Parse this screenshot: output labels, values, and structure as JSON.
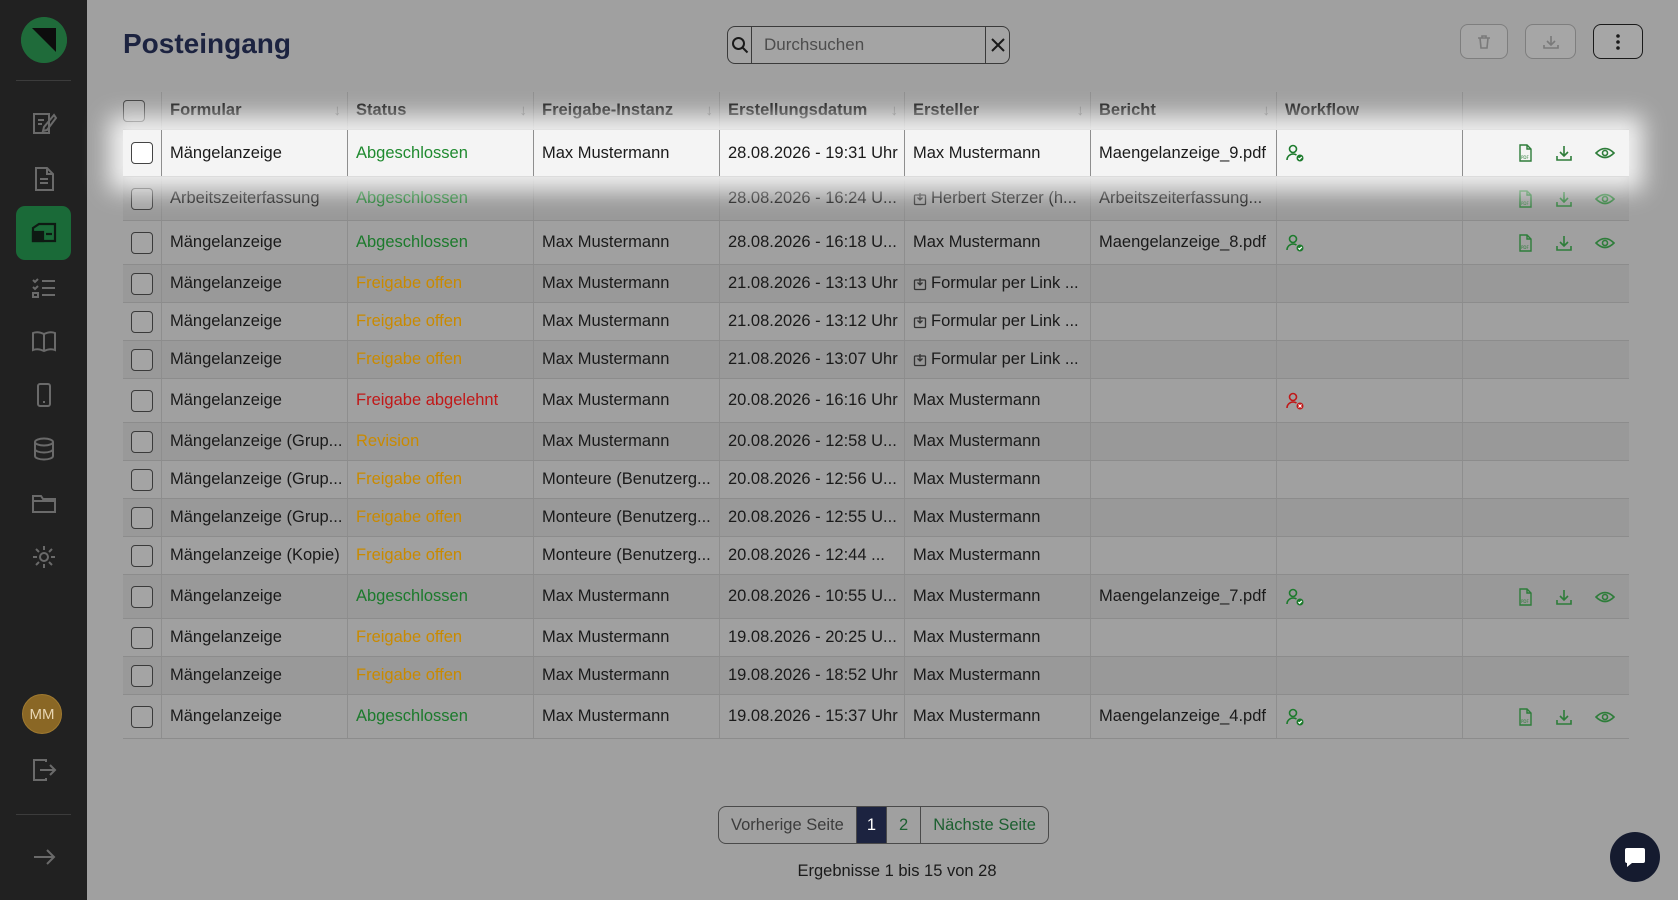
{
  "page": {
    "title": "Posteingang"
  },
  "search": {
    "placeholder": "Durchsuchen"
  },
  "user": {
    "initials": "MM"
  },
  "colors": {
    "accent": "#1a6a38",
    "brand_dark": "#1c2340",
    "status_done": "#1c7a2c",
    "status_open": "#c98a00",
    "status_rejected": "#c01818"
  },
  "sidebar": {
    "items": [
      {
        "icon": "form-edit-icon"
      },
      {
        "icon": "document-icon"
      },
      {
        "icon": "inbox-icon",
        "active": true
      },
      {
        "icon": "checklist-icon"
      },
      {
        "icon": "book-icon"
      },
      {
        "icon": "mobile-icon"
      },
      {
        "icon": "database-icon"
      },
      {
        "icon": "folder-icon"
      },
      {
        "icon": "gear-icon"
      }
    ]
  },
  "table": {
    "headers": [
      "Formular",
      "Status",
      "Freigabe-Instanz",
      "Erstellungsdatum",
      "Ersteller",
      "Bericht",
      "Workflow"
    ],
    "rows": [
      {
        "form": "Mängelanzeige",
        "status": "Abgeschlossen",
        "statusType": "done",
        "instanz": "Max Mustermann",
        "date": "28.08.2026 - 19:31 Uhr",
        "creator": "Max Mustermann",
        "linkCreator": false,
        "report": "Maengelanzeige_9.pdf",
        "workflow": "approved",
        "actions": true,
        "highlight": true
      },
      {
        "form": "Arbeitszeiterfassung",
        "status": "Abgeschlossen",
        "statusType": "done",
        "instanz": "",
        "date": "28.08.2026 - 16:24 U...",
        "creator": "Herbert Sterzer (h...",
        "linkCreator": true,
        "report": "Arbeitszeiterfassung...",
        "workflow": "",
        "actions": true
      },
      {
        "form": "Mängelanzeige",
        "status": "Abgeschlossen",
        "statusType": "done",
        "instanz": "Max Mustermann",
        "date": "28.08.2026 - 16:18 U...",
        "creator": "Max Mustermann",
        "linkCreator": false,
        "report": "Maengelanzeige_8.pdf",
        "workflow": "approved",
        "actions": true
      },
      {
        "form": "Mängelanzeige",
        "status": "Freigabe offen",
        "statusType": "open",
        "instanz": "Max Mustermann",
        "date": "21.08.2026 - 13:13 Uhr",
        "creator": "Formular per Link ...",
        "linkCreator": true,
        "report": "",
        "workflow": "",
        "actions": false
      },
      {
        "form": "Mängelanzeige",
        "status": "Freigabe offen",
        "statusType": "open",
        "instanz": "Max Mustermann",
        "date": "21.08.2026 - 13:12 Uhr",
        "creator": "Formular per Link ...",
        "linkCreator": true,
        "report": "",
        "workflow": "",
        "actions": false
      },
      {
        "form": "Mängelanzeige",
        "status": "Freigabe offen",
        "statusType": "open",
        "instanz": "Max Mustermann",
        "date": "21.08.2026 - 13:07 Uhr",
        "creator": "Formular per Link ...",
        "linkCreator": true,
        "report": "",
        "workflow": "",
        "actions": false
      },
      {
        "form": "Mängelanzeige",
        "status": "Freigabe abgelehnt",
        "statusType": "rejected",
        "instanz": "Max Mustermann",
        "date": "20.08.2026 - 16:16 Uhr",
        "creator": "Max Mustermann",
        "linkCreator": false,
        "report": "",
        "workflow": "rejected",
        "actions": false
      },
      {
        "form": "Mängelanzeige (Grup...",
        "status": "Revision",
        "statusType": "open",
        "instanz": "Max Mustermann",
        "date": "20.08.2026 - 12:58 U...",
        "creator": "Max Mustermann",
        "linkCreator": false,
        "report": "",
        "workflow": "",
        "actions": false
      },
      {
        "form": "Mängelanzeige (Grup...",
        "status": "Freigabe offen",
        "statusType": "open",
        "instanz": "Monteure (Benutzerg...",
        "date": "20.08.2026 - 12:56 U...",
        "creator": "Max Mustermann",
        "linkCreator": false,
        "report": "",
        "workflow": "",
        "actions": false
      },
      {
        "form": "Mängelanzeige (Grup...",
        "status": "Freigabe offen",
        "statusType": "open",
        "instanz": "Monteure (Benutzerg...",
        "date": "20.08.2026 - 12:55 U...",
        "creator": "Max Mustermann",
        "linkCreator": false,
        "report": "",
        "workflow": "",
        "actions": false
      },
      {
        "form": "Mängelanzeige (Kopie)",
        "status": "Freigabe offen",
        "statusType": "open",
        "instanz": "Monteure (Benutzerg...",
        "date": "20.08.2026 - 12:44 ...",
        "creator": "Max Mustermann",
        "linkCreator": false,
        "report": "",
        "workflow": "",
        "actions": false
      },
      {
        "form": "Mängelanzeige",
        "status": "Abgeschlossen",
        "statusType": "done",
        "instanz": "Max Mustermann",
        "date": "20.08.2026 - 10:55 U...",
        "creator": "Max Mustermann",
        "linkCreator": false,
        "report": "Maengelanzeige_7.pdf",
        "workflow": "approved",
        "actions": true
      },
      {
        "form": "Mängelanzeige",
        "status": "Freigabe offen",
        "statusType": "open",
        "instanz": "Max Mustermann",
        "date": "19.08.2026 - 20:25 U...",
        "creator": "Max Mustermann",
        "linkCreator": false,
        "report": "",
        "workflow": "",
        "actions": false
      },
      {
        "form": "Mängelanzeige",
        "status": "Freigabe offen",
        "statusType": "open",
        "instanz": "Max Mustermann",
        "date": "19.08.2026 - 18:52 Uhr",
        "creator": "Max Mustermann",
        "linkCreator": false,
        "report": "",
        "workflow": "",
        "actions": false
      },
      {
        "form": "Mängelanzeige",
        "status": "Abgeschlossen",
        "statusType": "done",
        "instanz": "Max Mustermann",
        "date": "19.08.2026 - 15:37 Uhr",
        "creator": "Max Mustermann",
        "linkCreator": false,
        "report": "Maengelanzeige_4.pdf",
        "workflow": "approved",
        "actions": true
      }
    ]
  },
  "pagination": {
    "prev": "Vorherige Seite",
    "pages": [
      "1",
      "2"
    ],
    "current": "1",
    "next": "Nächste Seite"
  },
  "results": "Ergebnisse 1 bis 15 von 28"
}
